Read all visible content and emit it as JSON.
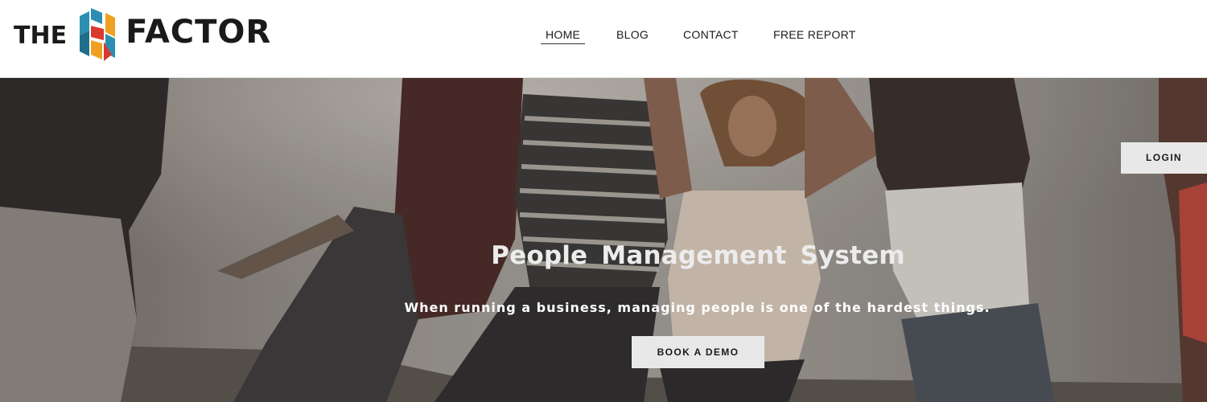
{
  "brand": {
    "the": "THE",
    "factor": "FACTOR",
    "icon": "h-mosaic-logo-icon",
    "colors": [
      "#2a8fb0",
      "#f0a020",
      "#d83a2e",
      "#1f6f8c"
    ]
  },
  "nav": {
    "items": [
      {
        "label": "HOME",
        "active": true
      },
      {
        "label": "BLOG",
        "active": false
      },
      {
        "label": "CONTACT",
        "active": false
      },
      {
        "label": "FREE REPORT",
        "active": false
      }
    ]
  },
  "hero": {
    "title": "People Management System",
    "subtitle": "When running a business, managing people is one of the hardest things.",
    "cta_label": "BOOK A DEMO",
    "login_label": "LOGIN"
  }
}
